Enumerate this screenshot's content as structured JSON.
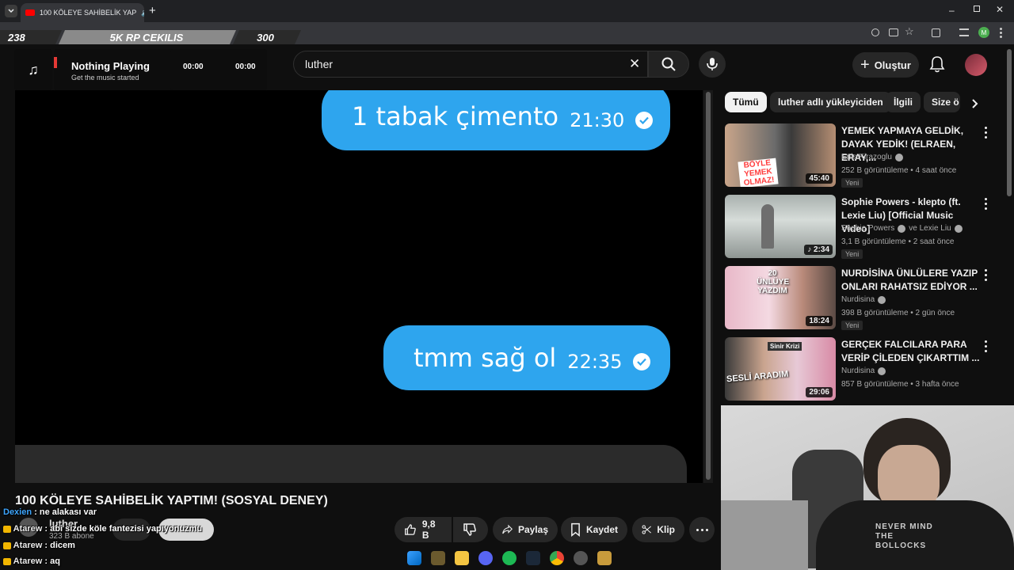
{
  "browser": {
    "tab_title": "100 KÖLEYE SAHİBELİK YAP",
    "profile_initial": "M"
  },
  "overlay": {
    "left_count": "238",
    "center_text": "5K RP CEKILIS",
    "right_count": "300"
  },
  "music_widget": {
    "title": "Nothing Playing",
    "subtitle": "Get the music started",
    "time_current": "00:00",
    "time_total": "00:00"
  },
  "header": {
    "search_value": "luther",
    "create_label": "Oluştur"
  },
  "video": {
    "bubble1_text": "1 tabak çimento",
    "bubble1_time": "21:30",
    "bubble2_text": "tmm sağ ol",
    "bubble2_time": "22:35",
    "title": "100 KÖLEYE SAHİBELİK YAPTIM! (SOSYAL DENEY)",
    "channel_name": "luther",
    "subscribers": "323 B abone",
    "likes": "9,8 B",
    "share_label": "Paylaş",
    "save_label": "Kaydet",
    "clip_label": "Klip"
  },
  "chips": [
    "Tümü",
    "luther adlı yükleyiciden",
    "İlgili",
    "Size ö"
  ],
  "recommendations": [
    {
      "title": "YEMEK YAPMAYA GELDİK, DAYAK YEDİK! (ELRAEN, ERAY,...",
      "channel": "Enis Kirazoglu",
      "meta": "252 B görüntüleme • 4 saat önce",
      "badge": "Yeni",
      "duration": "45:40",
      "thumb_text": "BÖYLE YEMEK OLMAZ!"
    },
    {
      "title": "Sophie Powers - klepto (ft. Lexie Liu) [Official Music Video]",
      "channel": "Sophie Powers",
      "channel_extra": "ve Lexie Liu",
      "meta": "3,1 B görüntüleme • 2 saat önce",
      "badge": "Yeni",
      "duration": "2:34"
    },
    {
      "title": "NURDİSİNA ÜNLÜLERE YAZIP ONLARI RAHATSIZ EDİYOR ...",
      "channel": "Nurdisina",
      "meta": "398 B görüntüleme • 2 gün önce",
      "badge": "Yeni",
      "duration": "18:24",
      "thumb_text": "20 ÜNLÜYE YAZDIM"
    },
    {
      "title": "GERÇEK FALCILARA PARA VERİP ÇİLEDEN ÇIKARTTIM ...",
      "channel": "Nurdisina",
      "meta": "857 B görüntüleme • 3 hafta önce",
      "duration": "29:06",
      "thumb_text": "SESLİ ARADIM",
      "thumb_tag": "Sinir Krizi"
    }
  ],
  "chat": [
    {
      "nick": "Dexien",
      "message": "ne alakası var"
    },
    {
      "nick": "Atarew",
      "message": "abi sizde köle fantezisi yapıyonuzmu"
    },
    {
      "nick": "Atarew",
      "message": "dicem"
    },
    {
      "nick": "Atarew",
      "message": "aq"
    }
  ],
  "webcam_shirt_text": "NEVER MIND THE BOLLOCKS",
  "colors": {
    "bubble": "#2ea5ee",
    "youtube_red": "#ff0000",
    "background": "#0f0f0f"
  }
}
